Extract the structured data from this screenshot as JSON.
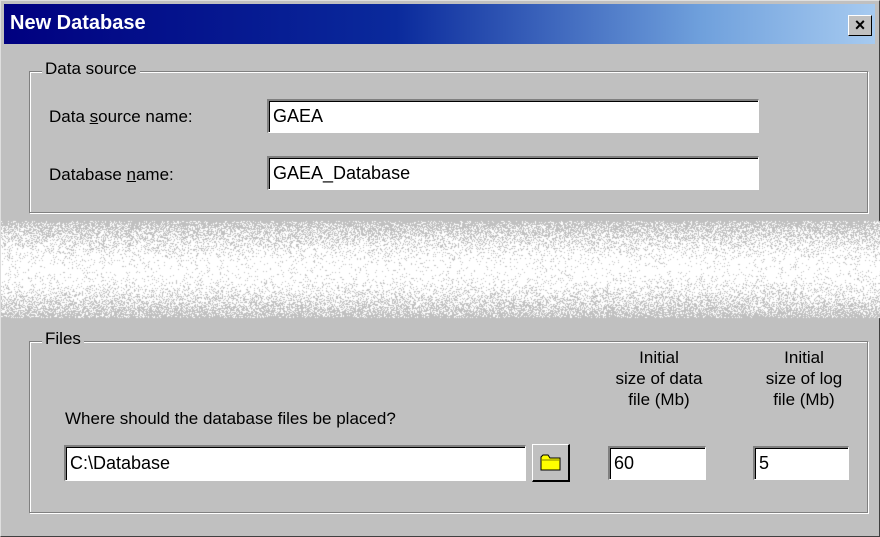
{
  "window": {
    "title": "New Database",
    "close_label": "×"
  },
  "data_source": {
    "legend": "Data source",
    "name_label_pre": "Data ",
    "name_label_u": "s",
    "name_label_post": "ource name:",
    "name_value": "GAEA",
    "db_label_pre": "Database ",
    "db_label_u": "n",
    "db_label_post": "ame:",
    "db_value": "GAEA_Database"
  },
  "files": {
    "legend": "Files",
    "location_prompt": "Where should the database files be placed?",
    "location_value": "C:\\Database",
    "data_size_label_1": "Initial",
    "data_size_label_2": "size of data",
    "data_size_label_3": "file (Mb)",
    "data_size_value": "60",
    "log_size_label_1": "Initial",
    "log_size_label_2": "size of log",
    "log_size_label_3": "file (Mb)",
    "log_size_value": "5"
  },
  "icons": {
    "browse": "folder-icon",
    "close": "close-icon"
  },
  "colors": {
    "title_bar_start": "#000080",
    "title_bar_end": "#a6caf0",
    "face": "#c0c0c0"
  }
}
